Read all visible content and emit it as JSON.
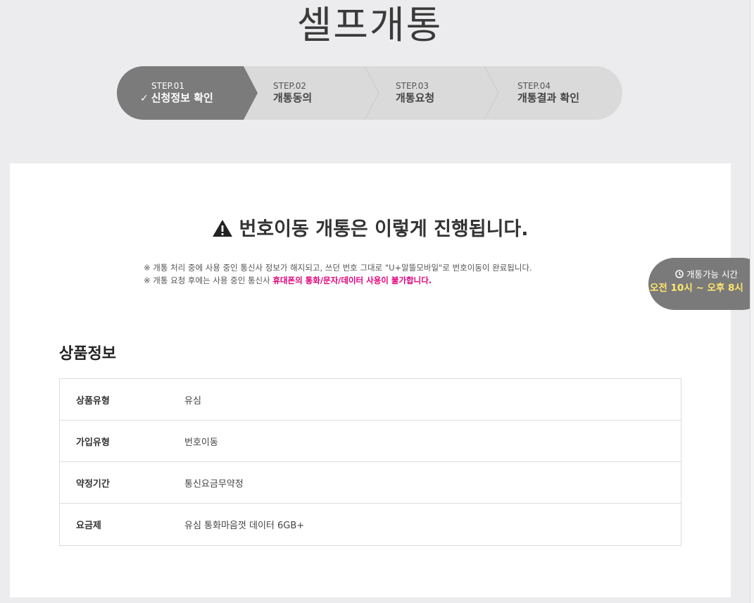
{
  "header": {
    "title": "셀프개통"
  },
  "stepper": {
    "steps": [
      {
        "num": "STEP.01",
        "label": "신청정보 확인",
        "active": true
      },
      {
        "num": "STEP.02",
        "label": "개통동의",
        "active": false
      },
      {
        "num": "STEP.03",
        "label": "개통요청",
        "active": false
      },
      {
        "num": "STEP.04",
        "label": "개통결과 확인",
        "active": false
      }
    ],
    "check_glyph": "✓"
  },
  "notice": {
    "heading": "번호이동 개통은 이렇게 진행됩니다.",
    "line1": "※ 개통 처리 중에 사용 중인 통신사 정보가 해지되고, 쓰던 번호 그대로 \"U+알뜰모바일\"로 번호이동이 완료됩니다.",
    "line2_prefix": "※ 개통 요청 후에는 사용 중인 통신사 ",
    "line2_highlight": "휴대폰의 통화/문자/데이터 사용이 불가합니다.",
    "highlight_color": "#e2007a"
  },
  "product_info": {
    "title": "상품정보",
    "rows": [
      {
        "key": "상품유형",
        "value": "유심"
      },
      {
        "key": "가입유형",
        "value": "번호이동"
      },
      {
        "key": "약정기간",
        "value": "통신요금무약정"
      },
      {
        "key": "요금제",
        "value": "유심 통화마음껏 데이터 6GB+"
      }
    ]
  },
  "hours_badge": {
    "title": "개통가능 시간",
    "time": "오전 10시 ~ 오후 8시",
    "time_color": "#ffe66d"
  },
  "colors": {
    "active_step": "#7b7b7b",
    "inactive_step": "#dadada",
    "page_bg": "#ececee"
  }
}
